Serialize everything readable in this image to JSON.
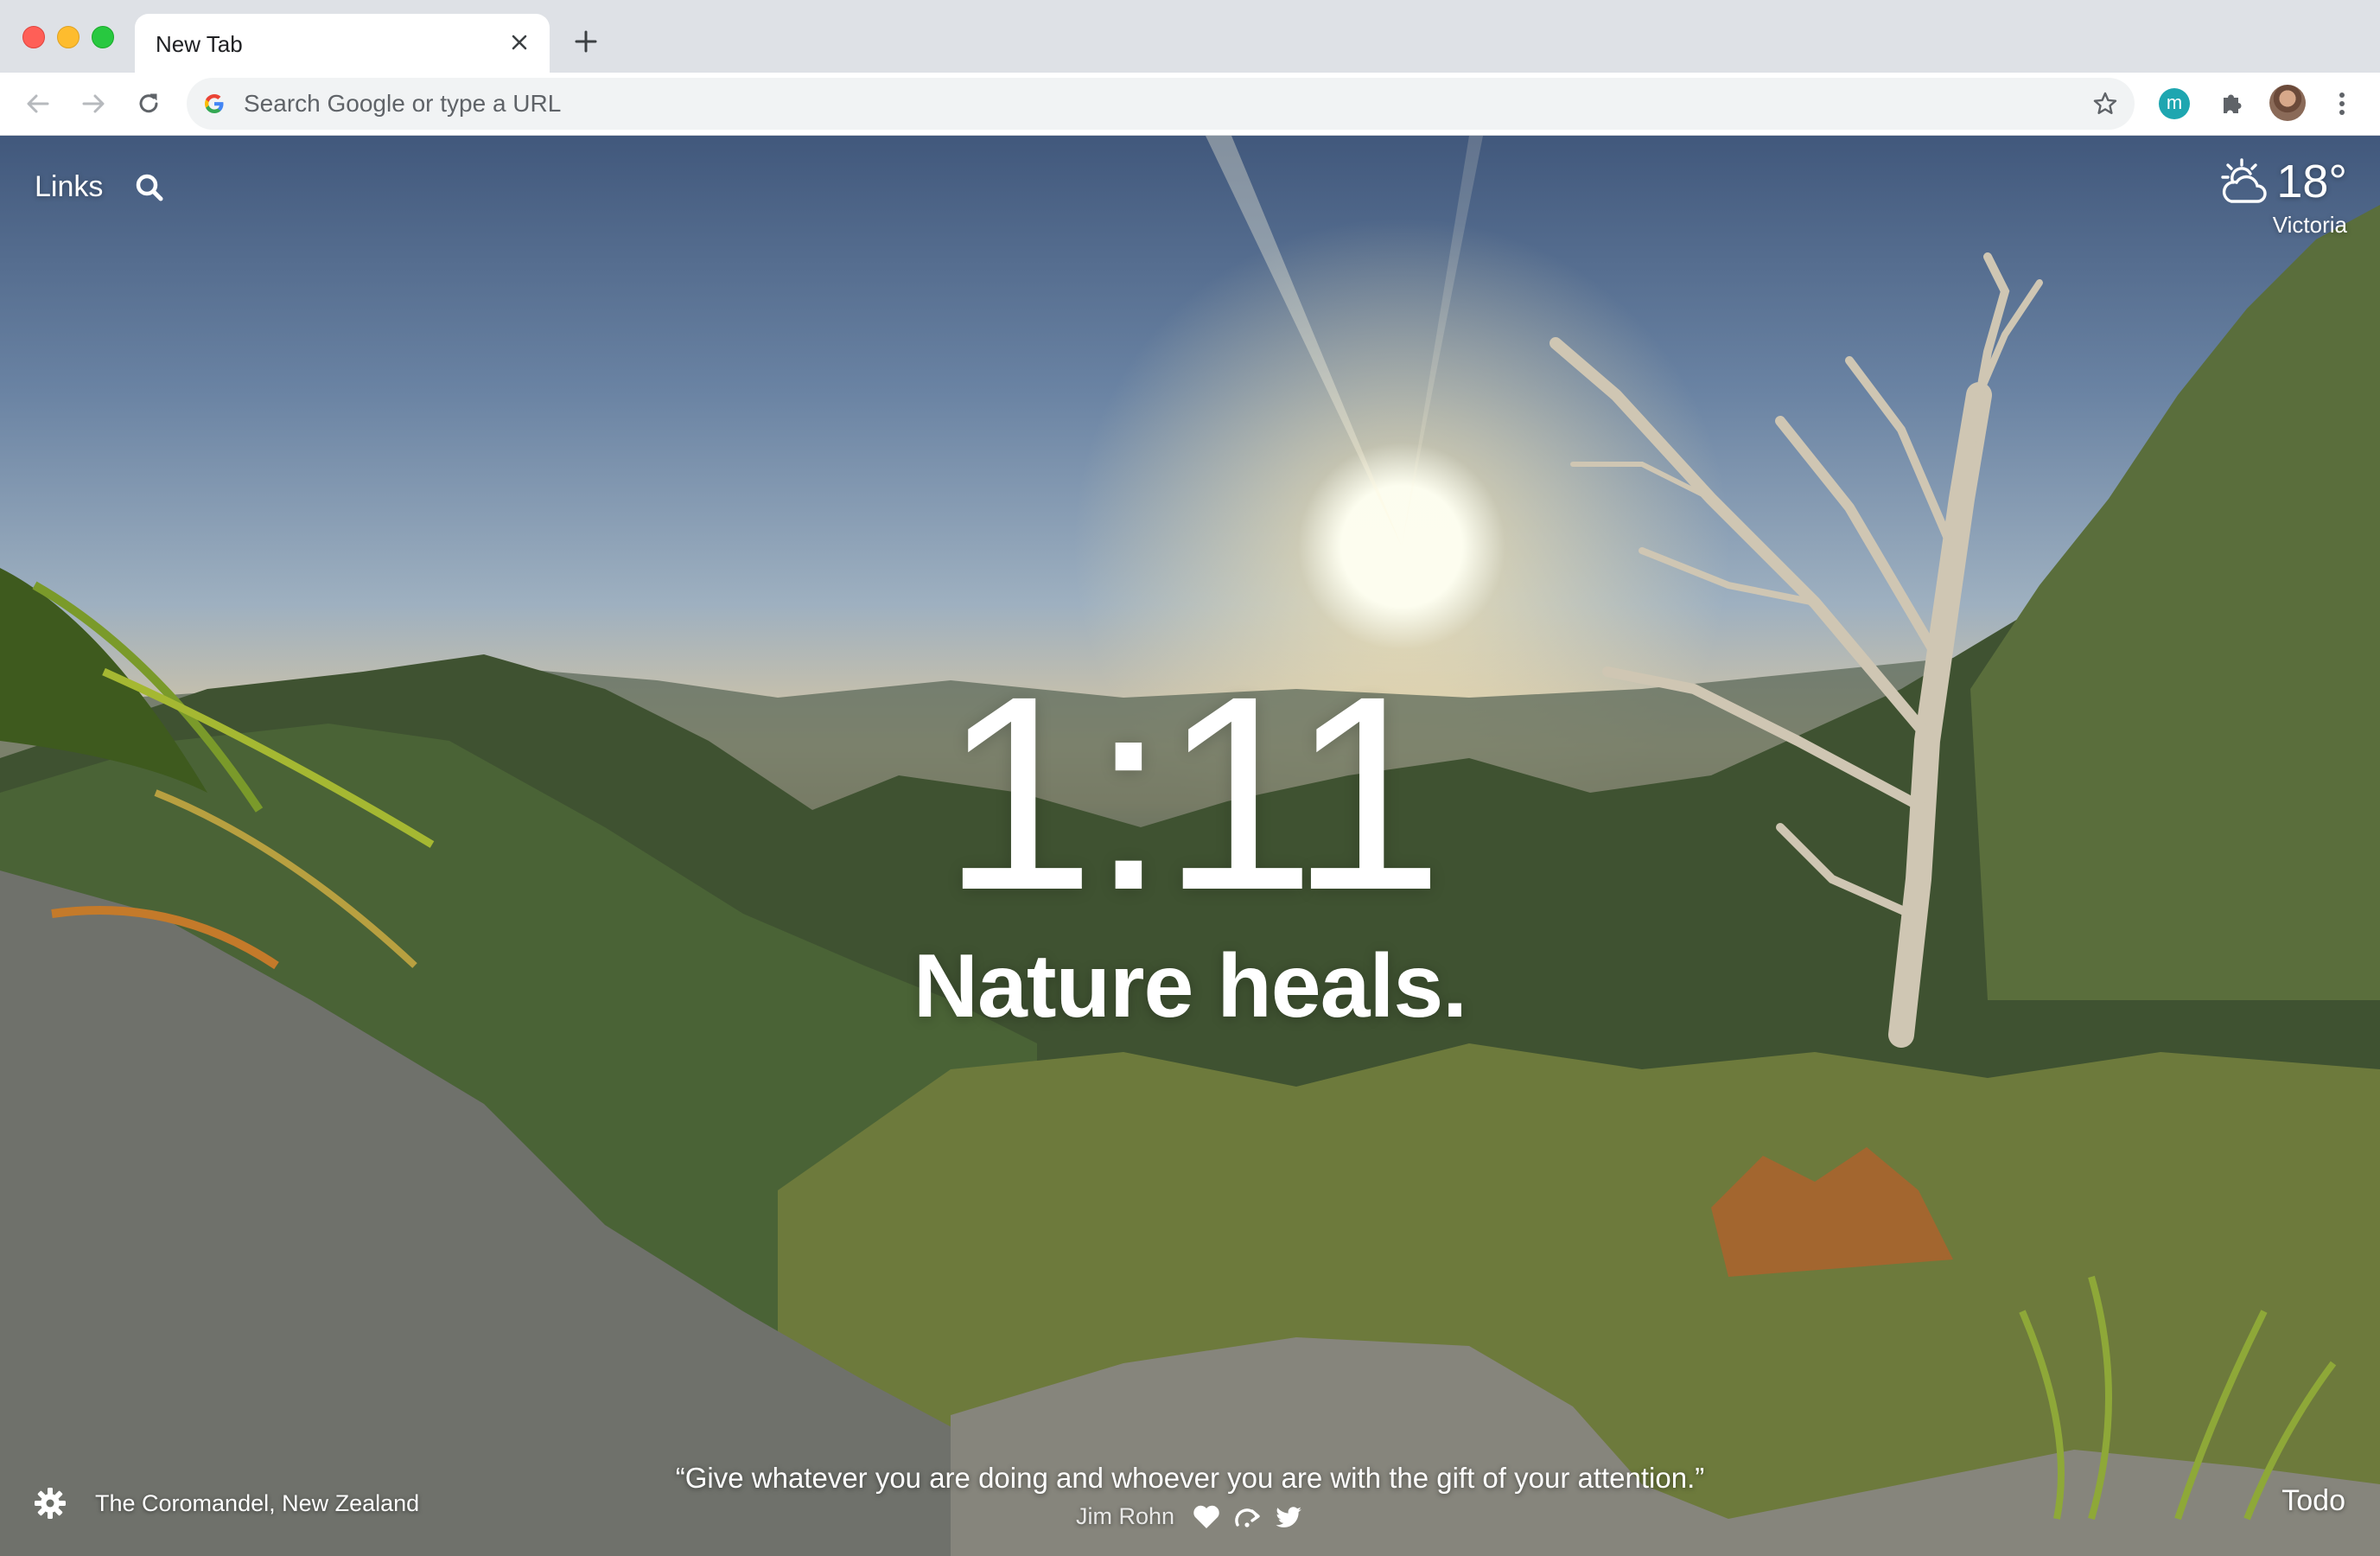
{
  "browser": {
    "tab_title": "New Tab",
    "omnibox_placeholder": "Search Google or type a URL",
    "extension_badge": "m"
  },
  "icons": {
    "back": "arrow-left-icon",
    "forward": "arrow-right-icon",
    "reload": "reload-icon",
    "google": "google-g-icon",
    "bookmark": "star-icon",
    "extensions": "puzzle-icon",
    "menu": "kebab-menu-icon",
    "search": "search-icon",
    "weather": "partly-cloudy-icon",
    "settings": "gear-icon",
    "favorite": "heart-icon",
    "skip": "skip-icon",
    "share": "twitter-icon"
  },
  "dashboard": {
    "links_label": "Links",
    "weather": {
      "temperature": "18°",
      "location": "Victoria"
    },
    "clock": "1:11",
    "mantra": "Nature heals.",
    "photo_location": "The Coromandel, New Zealand",
    "quote": {
      "text": "“Give whatever you are doing and whoever you are with the gift of your attention.”",
      "author": "Jim Rohn"
    },
    "todo_label": "Todo"
  },
  "colors": {
    "tab_strip": "#dee1e6",
    "omnibox_bg": "#f1f3f4",
    "extension_badge": "#1ea6b0",
    "traffic_close": "#ff5f57",
    "traffic_minimize": "#febc2e",
    "traffic_maximize": "#28c840"
  }
}
